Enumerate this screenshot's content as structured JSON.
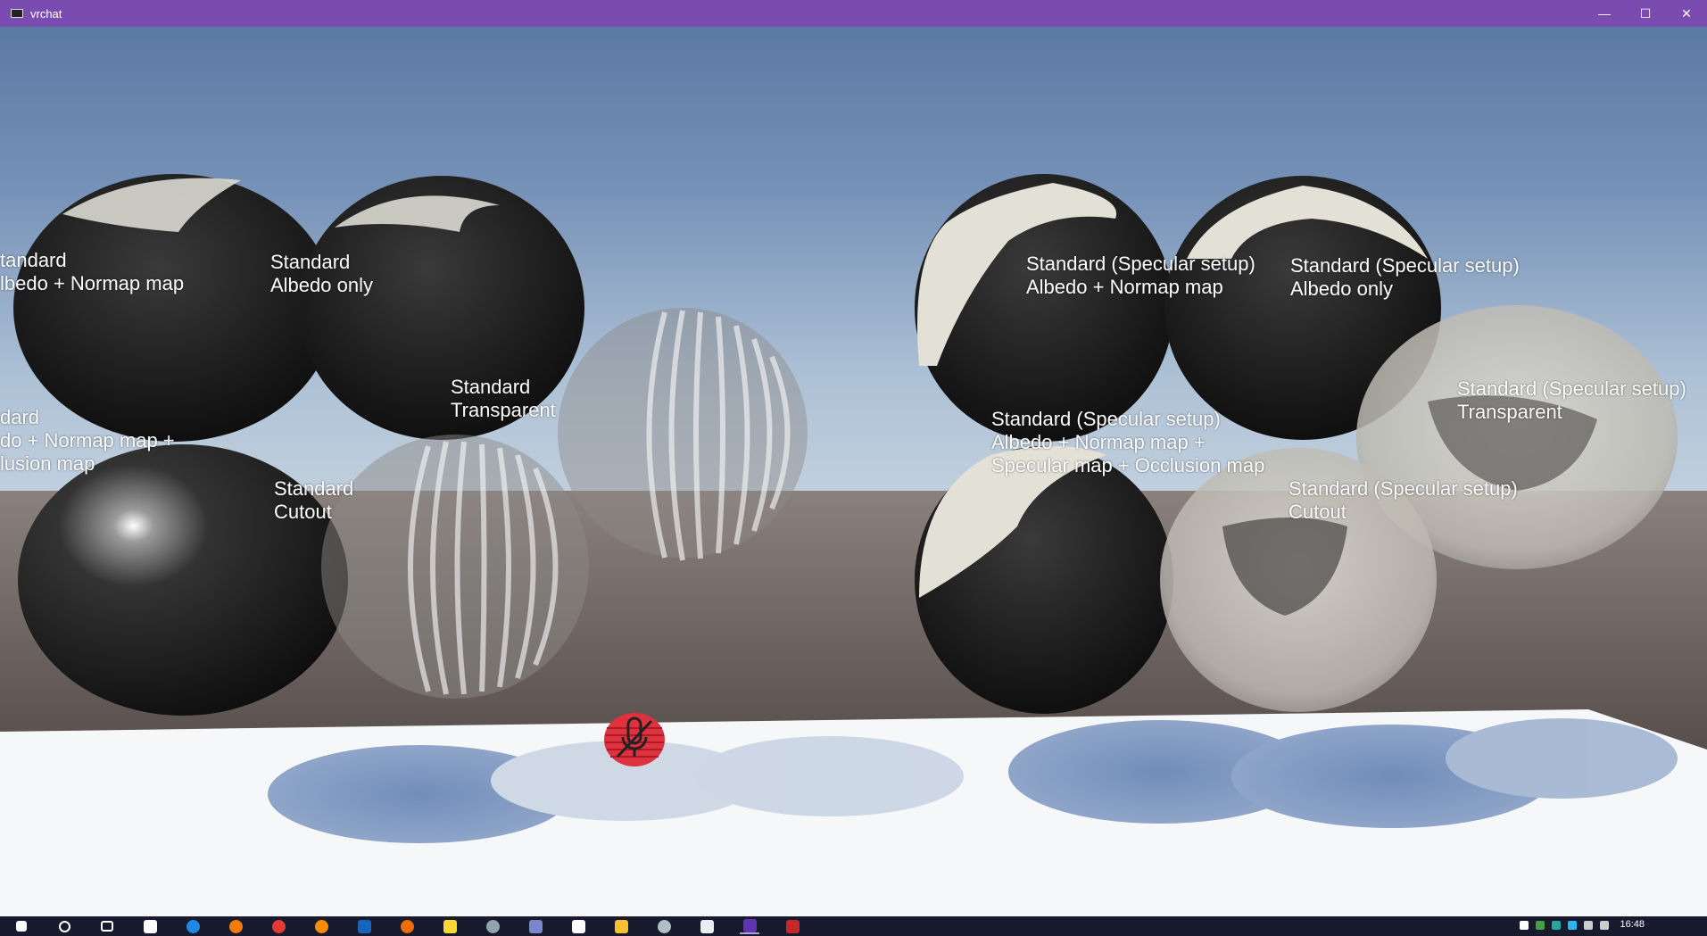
{
  "window": {
    "title": "vrchat"
  },
  "titlebar_buttons": {
    "minimize": "—",
    "maximize": "☐",
    "close": "✕"
  },
  "labels": [
    "tandard\nlbedo + Normap map",
    "Standard\nAlbedo only",
    "Standard\nTransparent",
    "dard\ndo + Normap map +\nlusion map",
    "Standard\nCutout",
    "Standard (Specular setup)\nAlbedo + Normap map",
    "Standard (Specular setup)\nAlbedo only",
    "Standard (Specular setup)\nTransparent",
    "Standard (Specular setup)\nAlbedo + Normap map +\nSpecular map + Occlusion map",
    "Standard (Specular setup)\nCutout"
  ],
  "taskbar": {
    "apps": [
      "start",
      "search",
      "task-view",
      "store",
      "edge",
      "firefox",
      "chrome",
      "chrome-alt",
      "outlook",
      "app-orange",
      "app-yellow",
      "steam",
      "discord",
      "app-white",
      "files",
      "app-gray",
      "unity",
      "vrchat",
      "app-red"
    ],
    "clock": "16:48"
  },
  "colors": {
    "titlebar": "#7b4cb0",
    "taskbar": "#181a2e",
    "sky_top": "#5a7aa8",
    "sky_horizon": "#a7bdd4",
    "ground": "#5e5553",
    "floor": "#ffffff"
  }
}
